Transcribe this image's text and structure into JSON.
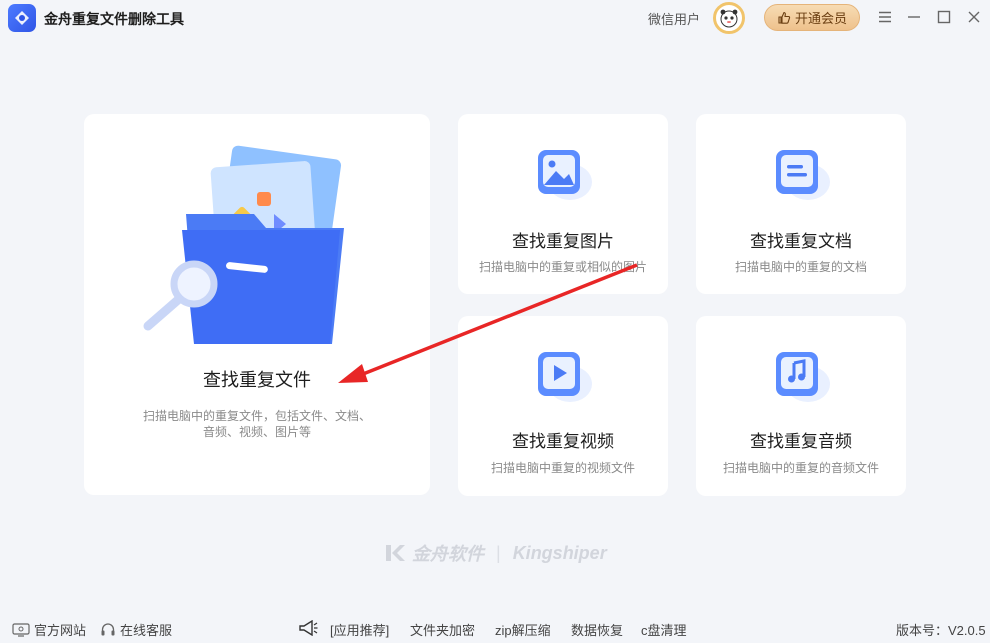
{
  "app": {
    "title": "金舟重复文件删除工具",
    "user_name": "微信用户",
    "vip_button": "开通会员"
  },
  "main_card": {
    "title": "查找重复文件",
    "desc_line1": "扫描电脑中的重复文件，包括文件、文档、",
    "desc_line2": "音频、视频、图片等"
  },
  "cards": [
    {
      "title": "查找重复图片",
      "desc": "扫描电脑中的重复或相似的图片",
      "icon": "image-icon"
    },
    {
      "title": "查找重复文档",
      "desc": "扫描电脑中的重复的文档",
      "icon": "document-icon"
    },
    {
      "title": "查找重复视频",
      "desc": "扫描电脑中重复的视频文件",
      "icon": "video-icon"
    },
    {
      "title": "查找重复音频",
      "desc": "扫描电脑中的重复的音频文件",
      "icon": "audio-icon"
    }
  ],
  "brand": {
    "cn": "金舟软件",
    "en": "Kingshiper"
  },
  "statusbar": {
    "official_site": "官方网站",
    "online_service": "在线客服",
    "app_recommend": "[应用推荐]",
    "links": [
      "文件夹加密",
      "zip解压缩",
      "数据恢复",
      "c盘清理"
    ],
    "version": "版本号：V2.0.5"
  },
  "colors": {
    "accent": "#3f6df5",
    "arrow": "#e82626",
    "vip_bg": "#eec18c"
  }
}
